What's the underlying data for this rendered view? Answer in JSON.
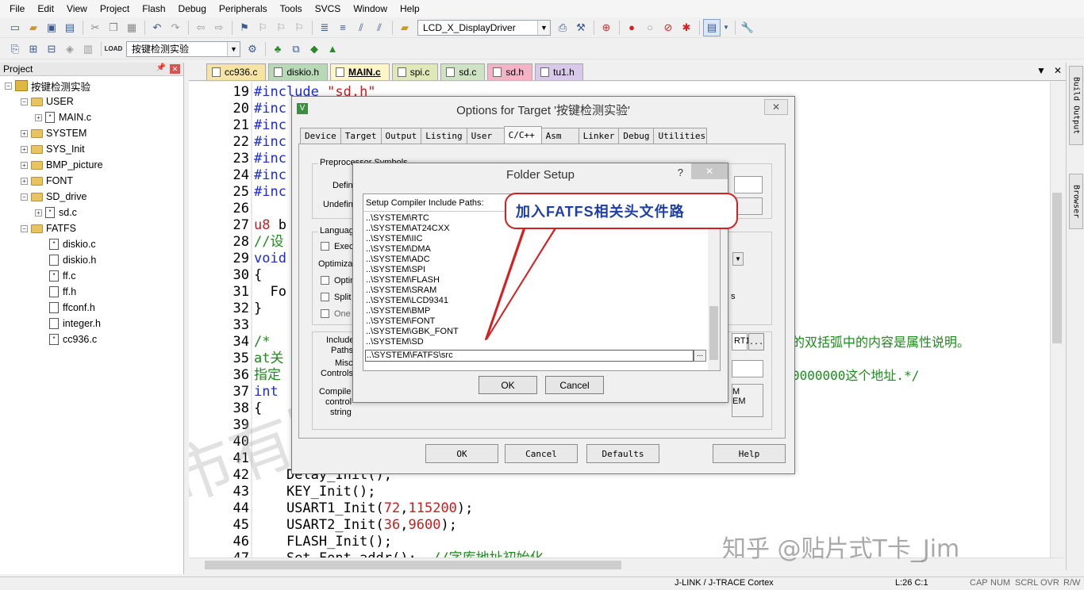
{
  "menu": [
    "File",
    "Edit",
    "View",
    "Project",
    "Flash",
    "Debug",
    "Peripherals",
    "Tools",
    "SVCS",
    "Window",
    "Help"
  ],
  "toolbar1": {
    "combo_value": "LCD_X_DisplayDriver"
  },
  "toolbar2": {
    "target_combo": "按键检测实验",
    "load_label": "LOAD"
  },
  "project": {
    "title": "Project",
    "root": "按键检测实验",
    "nodes": [
      "USER",
      "MAIN.c",
      "SYSTEM",
      "SYS_Init",
      "BMP_picture",
      "FONT",
      "SD_drive",
      "sd.c",
      "FATFS",
      "diskio.c",
      "diskio.h",
      "ff.c",
      "ff.h",
      "ffconf.h",
      "integer.h",
      "cc936.c"
    ]
  },
  "tabs": [
    {
      "label": "cc936.c",
      "color": "#f6e3a6"
    },
    {
      "label": "diskio.h",
      "color": "#b8d9b6"
    },
    {
      "label": "MAIN.c",
      "color": "#fff6c8"
    },
    {
      "label": "spi.c",
      "color": "#dfe8b6"
    },
    {
      "label": "sd.c",
      "color": "#cde3c4"
    },
    {
      "label": "sd.h",
      "color": "#f4b4c6"
    },
    {
      "label": "tu1.h",
      "color": "#d8c8ea"
    }
  ],
  "editor": {
    "line_numbers": [
      "19",
      "20",
      "21",
      "22",
      "23",
      "24",
      "25",
      "26",
      "27",
      "28",
      "29",
      "30",
      "31",
      "32",
      "33",
      "34",
      "35",
      "36",
      "37",
      "38",
      "39",
      "40",
      "41",
      "42",
      "43",
      "44",
      "45",
      "46",
      "47"
    ],
    "code": {
      "l19a": "#include ",
      "l19b": "\"sd.h\"",
      "l20": "#inc",
      "l21": "#inc",
      "l22": "#inc",
      "l23": "#inc",
      "l24": "#inc",
      "l25": "#inc",
      "l27a": "u8",
      "l27b": " b",
      "l28": "//设",
      "l29": "void",
      "l30": "{",
      "l31": "  Fo",
      "l32": "}",
      "l34a": "/*",
      "l34b": "的双括弧中的内容是属性说明。",
      "l35": "at关",
      "l36a": "指定",
      "l36b": "0000000这个地址.*/",
      "l37": "int",
      "l38": "{",
      "l42": "    Delay_Init();",
      "l43": "    KEY_Init();",
      "l44a": "    USART1_Init(",
      "l44b": "72",
      "l44c": ",",
      "l44d": "115200",
      "l44e": ");",
      "l45a": "    USART2_Init(",
      "l45b": "36",
      "l45c": ",",
      "l45d": "9600",
      "l45e": ");",
      "l46": "    FLASH_Init();",
      "l47a": "    Set_Font_addr();",
      "l47b": "  //字库地址初始化"
    }
  },
  "options_dialog": {
    "title": "Options for Target '按键检测实验'",
    "close": "✕",
    "tabs": [
      "Device",
      "Target",
      "Output",
      "Listing",
      "User",
      "C/C++",
      "Asm",
      "Linker",
      "Debug",
      "Utilities"
    ],
    "active_tab": "C/C++",
    "preproc_group": "Preprocessor Symbols",
    "define_label": "Defin",
    "undefine_label": "Undefin",
    "language_group": "Languag",
    "exec_label": "Exec",
    "optim_label": "Optimizat",
    "opt_label": "Optin",
    "split_label": "Split",
    "one_label": "One",
    "right_s": "s",
    "include_label": "Include",
    "paths_label": "Paths",
    "include_value": "RT1",
    "misc_label": "Misc",
    "controls_label": "Controls",
    "compiler_label": "Compile",
    "control_label": "control",
    "string_label": "string",
    "compiler_text1": "M",
    "compiler_text2": "EM",
    "browse": "...",
    "buttons": {
      "ok": "OK",
      "cancel": "Cancel",
      "defaults": "Defaults",
      "help": "Help"
    }
  },
  "folder_dialog": {
    "title": "Folder Setup",
    "help": "?",
    "close": "✕",
    "header": "Setup Compiler Include Paths:",
    "paths": [
      "..\\SYSTEM\\RTC",
      "..\\SYSTEM\\AT24CXX",
      "..\\SYSTEM\\IIC",
      "..\\SYSTEM\\DMA",
      "..\\SYSTEM\\ADC",
      "..\\SYSTEM\\SPI",
      "..\\SYSTEM\\FLASH",
      "..\\SYSTEM\\SRAM",
      "..\\SYSTEM\\LCD9341",
      "..\\SYSTEM\\BMP",
      "..\\SYSTEM\\FONT",
      "..\\SYSTEM\\GBK_FONT",
      "..\\SYSTEM\\SD"
    ],
    "editing_value": "..\\SYSTEM\\FATFS\\src",
    "browse": "...",
    "ok": "OK",
    "cancel": "Cancel"
  },
  "callout": "加入FATFS相关头文件路",
  "right_panel": {
    "build_output": "Build Output",
    "browser": "Browser"
  },
  "status": {
    "debugger": "J-LINK / J-TRACE Cortex",
    "position": "L:26 C:1",
    "cap": "CAP",
    "num": "NUM",
    "scrl": "SCRL",
    "ovr": "OVR",
    "rw": "R/W"
  },
  "watermarks": {
    "bg": "深圳市有限公司",
    "zhihu": "知乎 @贴片式T卡_Jim"
  }
}
